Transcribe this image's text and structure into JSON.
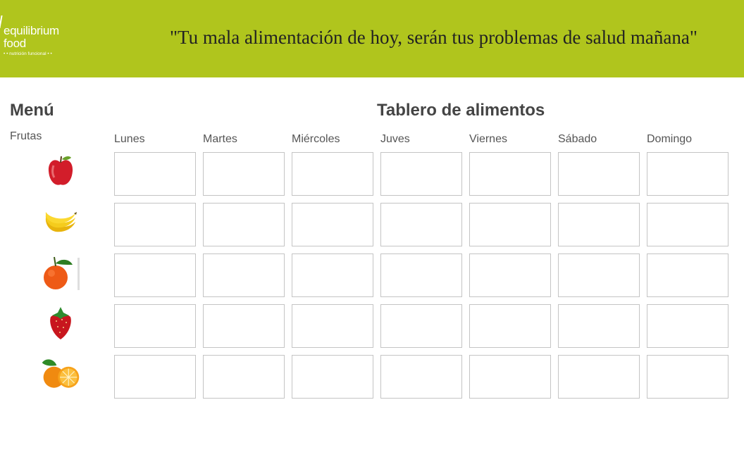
{
  "header": {
    "logo": {
      "line1": "equilibrium",
      "line2": "food",
      "tagline": "• • nutrición funcional • •"
    },
    "quote": "\"Tu mala alimentación de hoy, serán tus problemas de salud mañana\"",
    "background_color": "#b0c51d"
  },
  "menu": {
    "title": "Menú",
    "category": "Frutas",
    "items": [
      {
        "name": "apple",
        "icon": "apple-icon"
      },
      {
        "name": "banana",
        "icon": "banana-icon"
      },
      {
        "name": "tangerine",
        "icon": "tangerine-icon"
      },
      {
        "name": "strawberry",
        "icon": "strawberry-icon"
      },
      {
        "name": "orange",
        "icon": "orange-icon"
      }
    ]
  },
  "board": {
    "title": "Tablero de alimentos",
    "days": [
      "Lunes",
      "Martes",
      "Miércoles",
      "Juves",
      "Viernes",
      "Sábado",
      "Domingo"
    ],
    "row_count": 5
  }
}
